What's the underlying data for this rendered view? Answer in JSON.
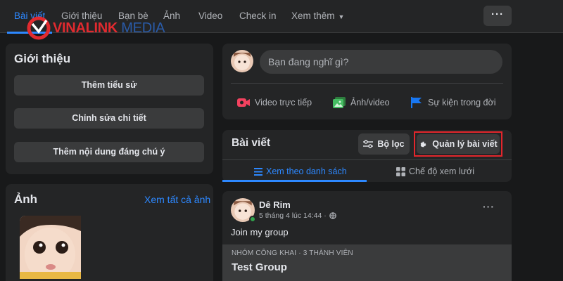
{
  "nav": {
    "tabs": [
      {
        "label": "Bài viết",
        "active": true
      },
      {
        "label": "Giới thiệu"
      },
      {
        "label": "Bạn bè"
      },
      {
        "label": "Ảnh"
      },
      {
        "label": "Video"
      },
      {
        "label": "Check in"
      },
      {
        "label": "Xem thêm"
      }
    ],
    "more_button_label": "···"
  },
  "watermark": {
    "brand_part1": "VINALINK",
    "brand_part2": " MEDIA"
  },
  "intro": {
    "title": "Giới thiệu",
    "buttons": [
      "Thêm tiểu sử",
      "Chỉnh sửa chi tiết",
      "Thêm nội dung đáng chú ý"
    ]
  },
  "photos": {
    "title": "Ảnh",
    "see_all": "Xem tất cả ảnh"
  },
  "composer": {
    "placeholder": "Bạn đang nghĩ gì?",
    "actions": [
      {
        "label": "Video trực tiếp",
        "icon": "live-video-icon",
        "color": "#f3425f"
      },
      {
        "label": "Ảnh/video",
        "icon": "photo-icon",
        "color": "#45bd62"
      },
      {
        "label": "Sự kiện trong đời",
        "icon": "flag-icon",
        "color": "#1877f2"
      }
    ]
  },
  "posts": {
    "title": "Bài viết",
    "filter_label": "Bộ lọc",
    "manage_label": "Quản lý bài viết",
    "view_list": "Xem theo danh sách",
    "view_grid": "Chế độ xem lưới"
  },
  "post": {
    "author": "Dê Rim",
    "time": "5 tháng 4 lúc 14:44 ·",
    "text": "Join my group",
    "group_meta": "NHÓM CÔNG KHAI · 3 THÀNH VIÊN",
    "group_name": "Test Group",
    "menu_label": "···"
  },
  "colors": {
    "accent": "#2d88ff",
    "highlight_border": "#e3262c",
    "background": "#18191a",
    "card": "#242526"
  }
}
